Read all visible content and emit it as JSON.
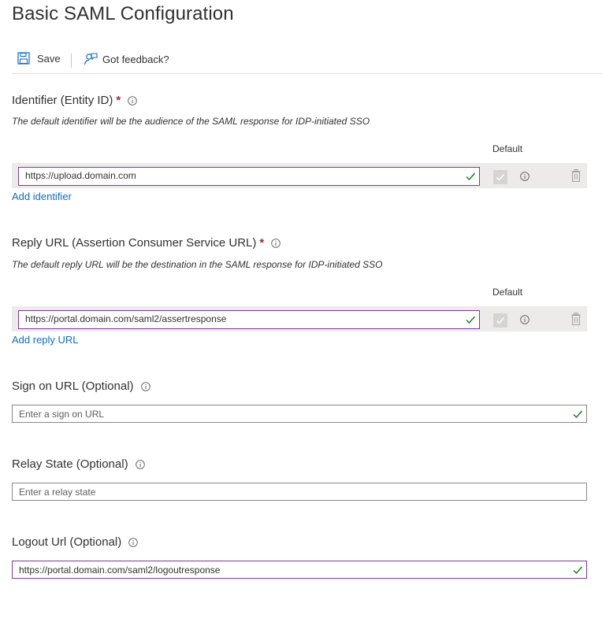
{
  "page": {
    "title": "Basic SAML Configuration"
  },
  "toolbar": {
    "save_label": "Save",
    "feedback_label": "Got feedback?"
  },
  "identifier": {
    "label": "Identifier (Entity ID)",
    "required_mark": "*",
    "description": "The default identifier will be the audience of the SAML response for IDP-initiated SSO",
    "default_col": "Default",
    "value": "https://upload.domain.com",
    "add_link": "Add identifier"
  },
  "reply_url": {
    "label": "Reply URL (Assertion Consumer Service URL)",
    "required_mark": "*",
    "description": "The default reply URL will be the destination in the SAML response for IDP-initiated SSO",
    "default_col": "Default",
    "value": "https://portal.domain.com/saml2/assertresponse",
    "add_link": "Add reply URL"
  },
  "sign_on": {
    "label": "Sign on URL (Optional)",
    "placeholder": "Enter a sign on URL"
  },
  "relay_state": {
    "label": "Relay State (Optional)",
    "placeholder": "Enter a relay state"
  },
  "logout": {
    "label": "Logout Url (Optional)",
    "value": "https://portal.domain.com/saml2/logoutresponse"
  },
  "colors": {
    "accent": "#0f6cbd",
    "valid_border": "#7b3b9a",
    "check": "#107c10",
    "required": "#a4262c"
  }
}
